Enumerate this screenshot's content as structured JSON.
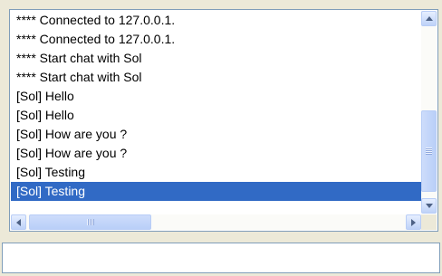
{
  "chat_log": {
    "lines": [
      "**** Connected to 127.0.0.1.",
      "**** Connected to 127.0.0.1.",
      "**** Start chat with Sol",
      "**** Start chat with Sol",
      "[Sol] Hello",
      "[Sol] Hello",
      "[Sol] How are you ?",
      "[Sol] How are you ?",
      "[Sol] Testing",
      "[Sol] Testing"
    ],
    "selected_index": 9
  },
  "message_input": {
    "value": ""
  },
  "icons": {
    "scroll_up": "chevron-up-icon",
    "scroll_down": "chevron-down-icon",
    "scroll_left": "chevron-left-icon",
    "scroll_right": "chevron-right-icon"
  },
  "colors": {
    "selection": "#316ac5",
    "border": "#7f9db9",
    "window_bg": "#ece9d8"
  }
}
